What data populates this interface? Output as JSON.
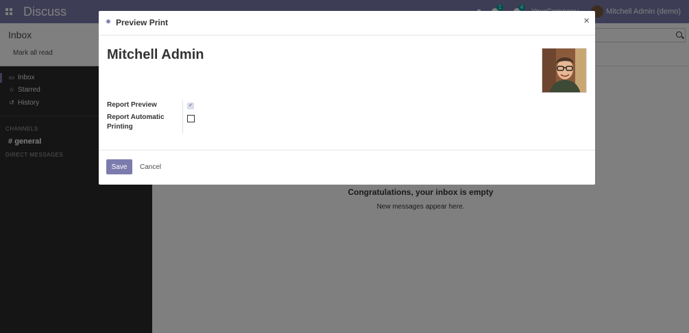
{
  "app": {
    "brand": "Discuss",
    "company": "YourCompany",
    "user_name": "Mitchell Admin (demo)",
    "messages_badge": "1",
    "activity_badge": "4"
  },
  "control_panel": {
    "title": "Inbox",
    "mark_all_read": "Mark all read"
  },
  "sidebar": {
    "items": [
      {
        "label": "Inbox",
        "icon": "inbox-icon"
      },
      {
        "label": "Starred",
        "icon": "star-icon"
      },
      {
        "label": "History",
        "icon": "history-icon"
      }
    ],
    "channels_header": "CHANNELS",
    "channel": "general",
    "direct_messages_header": "DIRECT MESSAGES"
  },
  "empty_state": {
    "title": "Congratulations, your inbox is empty",
    "subtitle": "New messages appear here."
  },
  "modal": {
    "title": "Preview Print",
    "record_name": "Mitchell Admin",
    "fields": [
      {
        "label": "Report Preview",
        "checked": true
      },
      {
        "label": "Report Automatic Printing",
        "checked": false
      }
    ],
    "save_label": "Save",
    "cancel_label": "Cancel",
    "close_symbol": "×"
  },
  "colors": {
    "brand": "#7c7bad",
    "sidebar_bg": "#2b2b2b",
    "badge": "#00a09d"
  }
}
